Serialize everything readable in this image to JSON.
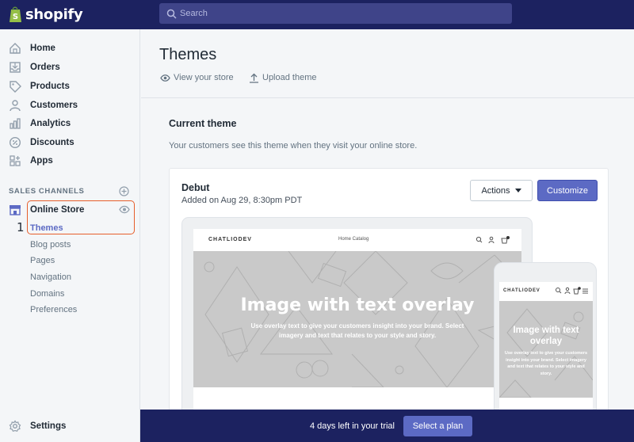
{
  "brand": {
    "name": "shopify"
  },
  "search": {
    "placeholder": "Search"
  },
  "sidebar": {
    "items": [
      {
        "label": "Home",
        "icon": "home-icon"
      },
      {
        "label": "Orders",
        "icon": "orders-icon"
      },
      {
        "label": "Products",
        "icon": "tag-icon"
      },
      {
        "label": "Customers",
        "icon": "person-icon"
      },
      {
        "label": "Analytics",
        "icon": "bar-chart-icon"
      },
      {
        "label": "Discounts",
        "icon": "discount-icon"
      },
      {
        "label": "Apps",
        "icon": "apps-icon"
      }
    ],
    "sales_channels_title": "SALES CHANNELS",
    "online_store": {
      "label": "Online Store",
      "step": "1"
    },
    "online_store_items": [
      "Themes",
      "Blog posts",
      "Pages",
      "Navigation",
      "Domains",
      "Preferences"
    ],
    "settings_label": "Settings"
  },
  "page": {
    "title": "Themes",
    "view_store_label": "View your store",
    "upload_theme_label": "Upload theme"
  },
  "current_theme": {
    "section_title": "Current theme",
    "description": "Your customers see this theme when they visit your online store.",
    "name": "Debut",
    "added": "Added on Aug 29, 8:30pm PDT",
    "actions_label": "Actions",
    "customize_label": "Customize"
  },
  "preview": {
    "store_name": "CHATLIODEV",
    "nav_links": "Home     Catalog",
    "hero_title": "Image with text overlay",
    "hero_subtitle": "Use overlay text to give your customers insight into your brand. Select imagery and text that relates to your style and story.",
    "mobile_hero_title": "Image with text overlay",
    "mobile_hero_subtitle": "Use overlay text to give your customers insight into your brand. Select imagery and text that relates to your style and story."
  },
  "trial": {
    "text": "4 days left in your trial",
    "button_label": "Select a plan"
  },
  "colors": {
    "topbar": "#1c2260",
    "accent": "#5c6ac4",
    "highlight_box": "#e65e2b"
  }
}
